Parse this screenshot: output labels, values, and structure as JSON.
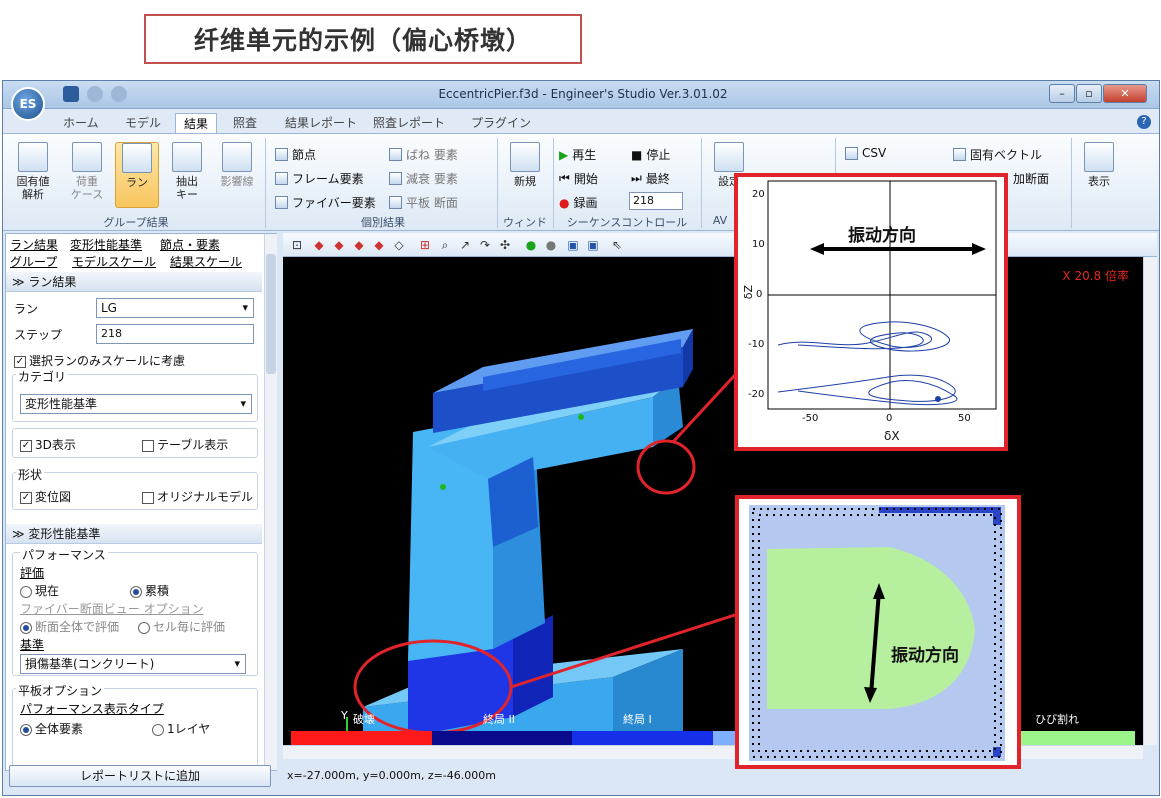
{
  "slide_title": "纤维单元的示例（偏心桥墩）",
  "window": {
    "title": "EccentricPier.f3d - Engineer's Studio Ver.3.01.02",
    "orb_label": "ES"
  },
  "tabs": [
    "ホーム",
    "モデル",
    "結果",
    "照査",
    "結果レポート",
    "照査レポート",
    "プラグイン"
  ],
  "ribbon": {
    "group_result": {
      "label": "グループ結果",
      "buttons": [
        "固有値\n解析",
        "荷重\nケース",
        "ラン",
        "抽出\nキー",
        "影響線"
      ]
    },
    "individual": {
      "label": "個別結果",
      "col1": [
        "節点",
        "フレーム要素",
        "ファイバー要素"
      ],
      "col2": [
        "ばね 要素",
        "減衰 要素",
        "平板 断面"
      ]
    },
    "window_group": {
      "label": "ウィンドウ",
      "new_label": "新規"
    },
    "sequence": {
      "label": "シーケンスコントロール",
      "play": "再生",
      "stop": "停止",
      "start": "開始",
      "last": "最終",
      "record": "録画",
      "step_value": "218"
    },
    "av_group": {
      "label": "AV",
      "setting": "設定"
    },
    "export": {
      "csv": "CSV",
      "eigen": "固有ベクトル",
      "section_partial": "加断面"
    },
    "display": {
      "label": "表示"
    }
  },
  "left_panel": {
    "links": [
      "ラン結果",
      "変形性能基準",
      "節点・要素",
      "グループ",
      "モデルスケール",
      "結果スケール"
    ],
    "run_section": "ラン結果",
    "run_label": "ラン",
    "run_value": "LG",
    "step_label": "ステップ",
    "step_value": "218",
    "scale_only": "選択ランのみスケールに考慮",
    "category_label": "カテゴリ",
    "category_value": "変形性能基準",
    "show_3d": "3D表示",
    "show_table": "テーブル表示",
    "shape_label": "形状",
    "displacement": "変位図",
    "original_model": "オリジナルモデル",
    "perf_section": "変形性能基準",
    "performance_label": "パフォーマンス",
    "eval_label": "評価",
    "eval_current": "現在",
    "eval_cumulative": "累積",
    "fiber_view_link": "ファイバー断面ビュー オプション",
    "whole_section": "断面全体で評価",
    "per_cell": "セル毎に評価",
    "criteria_label": "基準",
    "criteria_value": "損傷基準(コンクリート)",
    "plate_option": "平板オプション",
    "perf_display_type": "パフォーマンス表示タイプ",
    "all_elements": "全体要素",
    "one_layer": "1レイヤ",
    "add_report": "レポートリストに追加"
  },
  "viewport": {
    "scale_label": "X 20.8 倍率",
    "axis_y": "Y",
    "axis_z": "Z",
    "axis_x": "X",
    "legend": [
      "破壊",
      "終局 II",
      "終局 I",
      "",
      "",
      "ひび割れ"
    ],
    "legend_colors": [
      "#ff1a1a",
      "#0a0a8c",
      "#1530e8",
      "#7fb0ff",
      "#8fb4ff",
      "#9bf58a"
    ]
  },
  "status": "x=-27.000m, y=0.000m, z=-46.000m",
  "plot_popup": {
    "title": "振动方向",
    "xlabel": "δX",
    "ylabel": "δZ",
    "xticks": [
      "-50",
      "0",
      "50"
    ],
    "yticks": [
      "20",
      "10",
      "0",
      "-10",
      "-20"
    ]
  },
  "section_popup": {
    "title": "振动方向"
  },
  "colors": {
    "accent_red": "#e1242b",
    "section_green": "#b6f09e",
    "section_blue": "#b4c8f0"
  }
}
